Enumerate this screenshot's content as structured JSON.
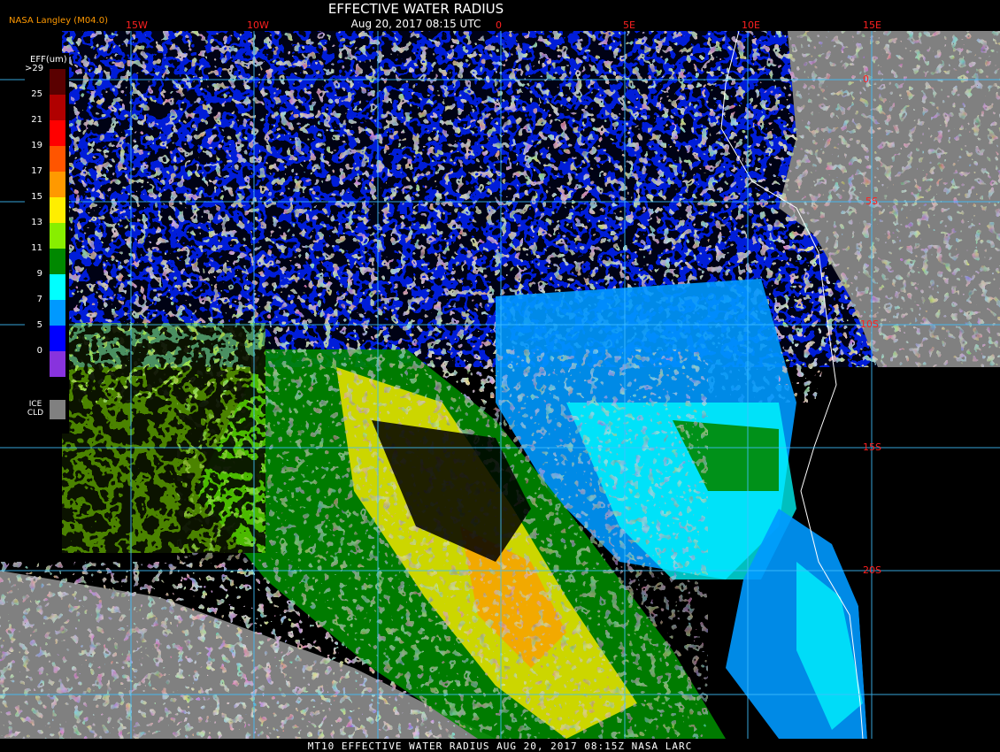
{
  "header": {
    "title": "EFFECTIVE WATER RADIUS",
    "subtitle": "Aug 20, 2017 08:15 UTC",
    "credit": "NASA Langley (M04.0)"
  },
  "footer": {
    "caption": "MT10  EFFECTIVE WATER RADIUS   AUG 20, 2017 08:15Z   NASA LARC"
  },
  "legend": {
    "title": "EFF(um)",
    "ticks": [
      ">29",
      "25",
      "21",
      "19",
      "17",
      "15",
      "13",
      "11",
      "9",
      "7",
      "5",
      "0"
    ],
    "colors": [
      "#5a0000",
      "#b00000",
      "#ff0000",
      "#ff5500",
      "#ff9900",
      "#ffee00",
      "#88ee00",
      "#008800",
      "#00ffff",
      "#0099ff",
      "#0000ff",
      "#8833dd"
    ],
    "ice_label": "ICE CLD",
    "ice_color": "#808080"
  },
  "grid": {
    "lon_labels": [
      "15W",
      "10W",
      "0",
      "5E",
      "10E",
      "15E"
    ],
    "lat_labels": [
      "0",
      "5S",
      "10S",
      "15S",
      "20S"
    ],
    "color": "#40c0ff",
    "label_color": "#ff2020"
  },
  "palette": {
    "land": "#808080",
    "ocean_clear": "#000000",
    "coast": "#ffffff"
  }
}
